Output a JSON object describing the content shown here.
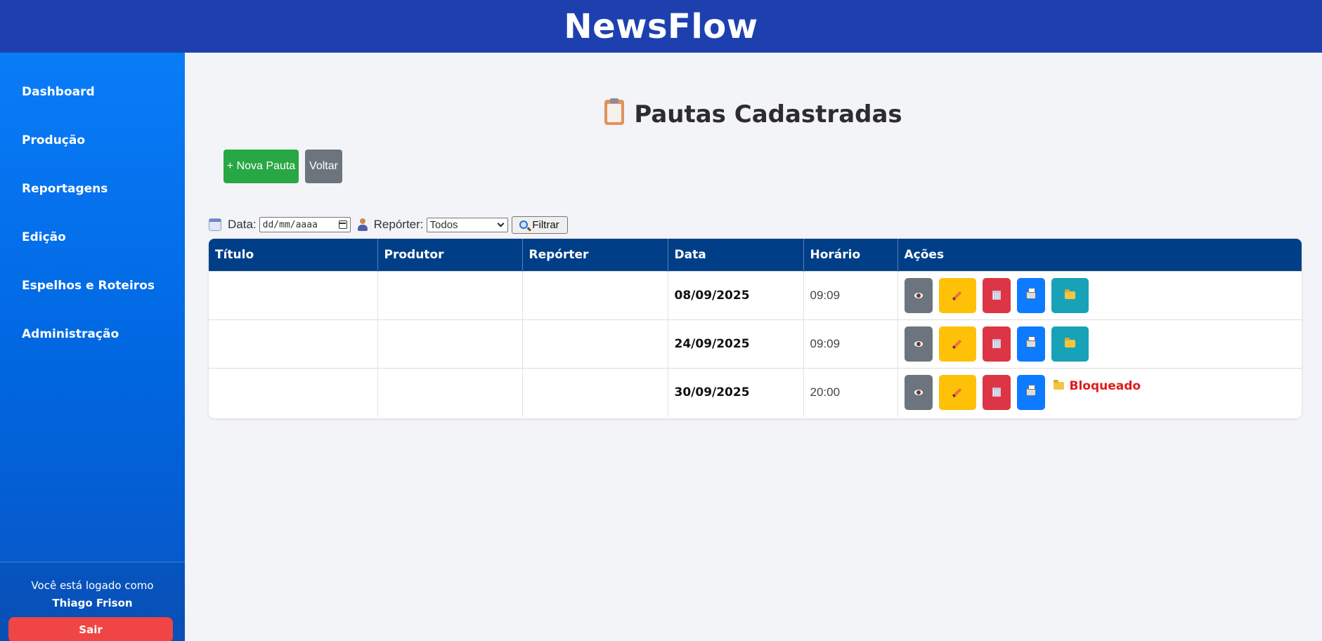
{
  "app": {
    "title": "NewsFlow"
  },
  "sidebar": {
    "items": [
      {
        "label": "Dashboard"
      },
      {
        "label": "Produção"
      },
      {
        "label": "Reportagens"
      },
      {
        "label": "Edição"
      },
      {
        "label": "Espelhos e Roteiros"
      },
      {
        "label": "Administração"
      }
    ],
    "logged_prefix": "Você está logado como",
    "user_name": "Thiago Frison",
    "logout_label": "Sair"
  },
  "page": {
    "title": "Pautas Cadastradas",
    "title_icon": "clipboard-icon",
    "new_button": "+ Nova Pauta",
    "back_button": "Voltar"
  },
  "filters": {
    "date_label": "Data:",
    "date_placeholder": "dd/mm/aaaa",
    "reporter_label": "Repórter:",
    "reporter_selected": "Todos",
    "filter_button": "Filtrar"
  },
  "table": {
    "columns": [
      "Título",
      "Produtor",
      "Repórter",
      "Data",
      "Horário",
      "Ações"
    ],
    "rows": [
      {
        "titulo": "",
        "produtor": "",
        "reporter": "",
        "data": "08/09/2025",
        "horario": "09:09",
        "status": ""
      },
      {
        "titulo": "",
        "produtor": "",
        "reporter": "",
        "data": "24/09/2025",
        "horario": "09:09",
        "status": ""
      },
      {
        "titulo": "",
        "produtor": "",
        "reporter": "",
        "data": "30/09/2025",
        "horario": "20:00",
        "status": "Bloqueado"
      }
    ]
  },
  "colors": {
    "topbar": "#1e40af",
    "sidebar": "#0a7cf8",
    "table_header": "#003f88",
    "success": "#28a745",
    "secondary": "#6c757d",
    "warning": "#ffc107",
    "danger": "#dc3545",
    "primary": "#0d7bff",
    "info": "#17a2b8",
    "blocked_text": "#e01b1b"
  }
}
